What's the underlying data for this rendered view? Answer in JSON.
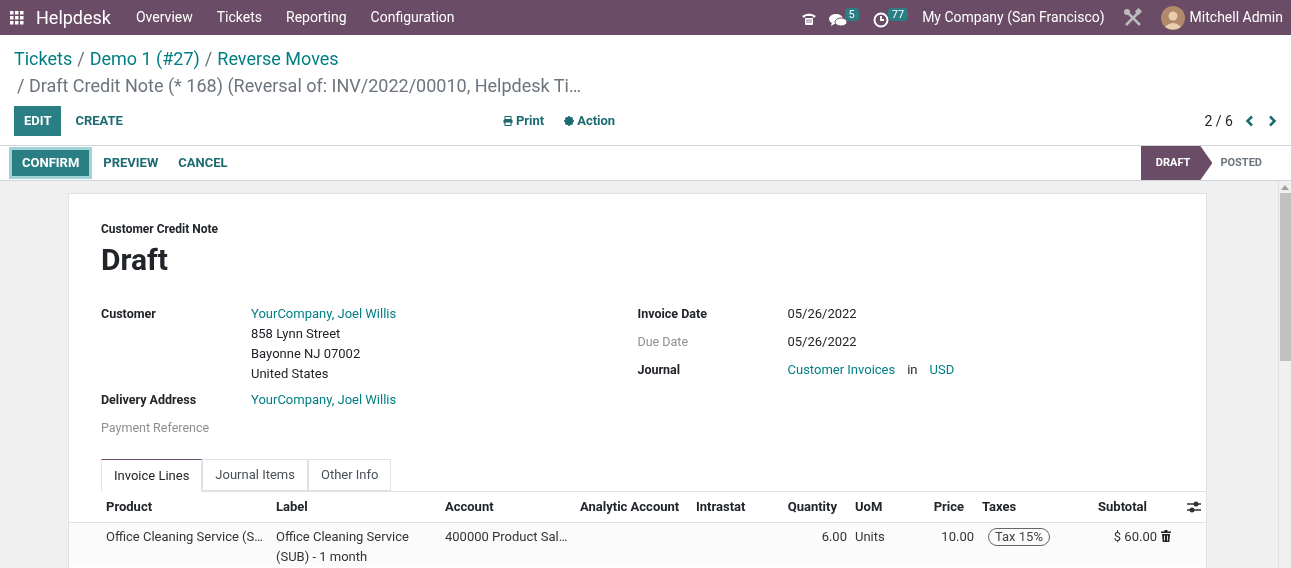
{
  "navbar": {
    "app_name": "Helpdesk",
    "menu": [
      "Overview",
      "Tickets",
      "Reporting",
      "Configuration"
    ],
    "messages_count": "5",
    "activities_count": "77",
    "company": "My Company (San Francisco)",
    "user": "Mitchell Admin"
  },
  "breadcrumbs": {
    "separator": "/",
    "items": [
      "Tickets",
      "Demo 1 (#27)",
      "Reverse Moves"
    ],
    "current": "/ Draft Credit Note (* 168) (Reversal of: INV/2022/00010, Helpdesk Ti…"
  },
  "toolbar": {
    "edit": "EDIT",
    "create": "CREATE",
    "print": "Print",
    "action": "Action",
    "pager": "2 / 6"
  },
  "header_buttons": [
    {
      "label": "CONFIRM",
      "primary": true
    },
    {
      "label": "PREVIEW",
      "primary": false
    },
    {
      "label": "CANCEL",
      "primary": false
    }
  ],
  "stages": [
    {
      "label": "DRAFT",
      "selected": true
    },
    {
      "label": "POSTED",
      "selected": false
    }
  ],
  "sheet": {
    "doc_type": "Customer Credit Note",
    "name": "Draft",
    "left_fields": [
      {
        "label": "Customer",
        "muted": false,
        "value": "YourCompany, Joel Willis",
        "address": [
          "858 Lynn Street",
          "Bayonne NJ 07002",
          "United States"
        ]
      },
      {
        "label": "Delivery Address",
        "muted": false,
        "value": "YourCompany, Joel Willis"
      },
      {
        "label": "Payment Reference",
        "muted": true
      }
    ],
    "right_fields": [
      {
        "label": "Invoice Date",
        "muted": false,
        "value": "05/26/2022"
      },
      {
        "label": "Due Date",
        "muted": true,
        "value": "05/26/2022"
      },
      {
        "label": "Journal",
        "muted": false,
        "value": "Customer Invoices",
        "joiner": "in",
        "value_2": "USD"
      }
    ],
    "tabs": [
      {
        "label": "Invoice Lines",
        "selected": true
      },
      {
        "label": "Journal Items",
        "selected": false
      },
      {
        "label": "Other Info",
        "selected": false
      }
    ],
    "table": {
      "columns": [
        "Product",
        "Label",
        "Account",
        "Analytic Account",
        "Intrastat",
        "Quantity",
        "UoM",
        "Price",
        "Taxes",
        "Subtotal"
      ],
      "rows": [
        {
          "product": "Office Cleaning Service (S…",
          "label": "Office Cleaning Service (SUB) - 1 month",
          "account": "400000 Product Sal…",
          "quantity": "6.00",
          "uom": "Units",
          "price": "10.00",
          "tax": "Tax 15%",
          "subtotal": "$ 60.00"
        }
      ]
    }
  }
}
